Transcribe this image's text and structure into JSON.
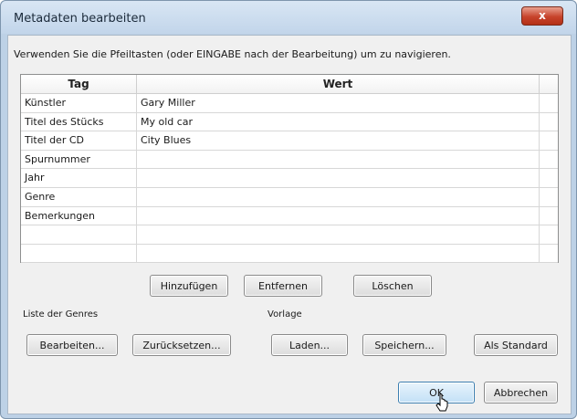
{
  "window": {
    "title": "Metadaten bearbeiten",
    "close_label": "x"
  },
  "instruction": "Verwenden Sie die Pfeiltasten (oder EINGABE nach der Bearbeitung) um zu navigieren.",
  "table": {
    "headers": {
      "tag": "Tag",
      "wert": "Wert"
    },
    "rows": [
      {
        "tag": "Künstler",
        "wert": "Gary Miller"
      },
      {
        "tag": "Titel des Stücks",
        "wert": "My old car"
      },
      {
        "tag": "Titel der CD",
        "wert": "City Blues"
      },
      {
        "tag": "Spurnummer",
        "wert": ""
      },
      {
        "tag": "Jahr",
        "wert": ""
      },
      {
        "tag": "Genre",
        "wert": ""
      },
      {
        "tag": "Bemerkungen",
        "wert": ""
      },
      {
        "tag": "",
        "wert": ""
      },
      {
        "tag": "",
        "wert": ""
      }
    ]
  },
  "row_buttons": {
    "add": "Hinzufügen",
    "remove": "Entfernen",
    "clear": "Löschen"
  },
  "genres": {
    "label": "Liste der Genres",
    "edit": "Bearbeiten...",
    "reset": "Zurücksetzen..."
  },
  "template": {
    "label": "Vorlage",
    "load": "Laden...",
    "save": "Speichern...",
    "default": "Als Standard"
  },
  "dialog": {
    "ok": "OK",
    "cancel": "Abbrechen"
  },
  "icons": {
    "cursor": "mouse-pointer-icon",
    "close": "close-icon"
  }
}
